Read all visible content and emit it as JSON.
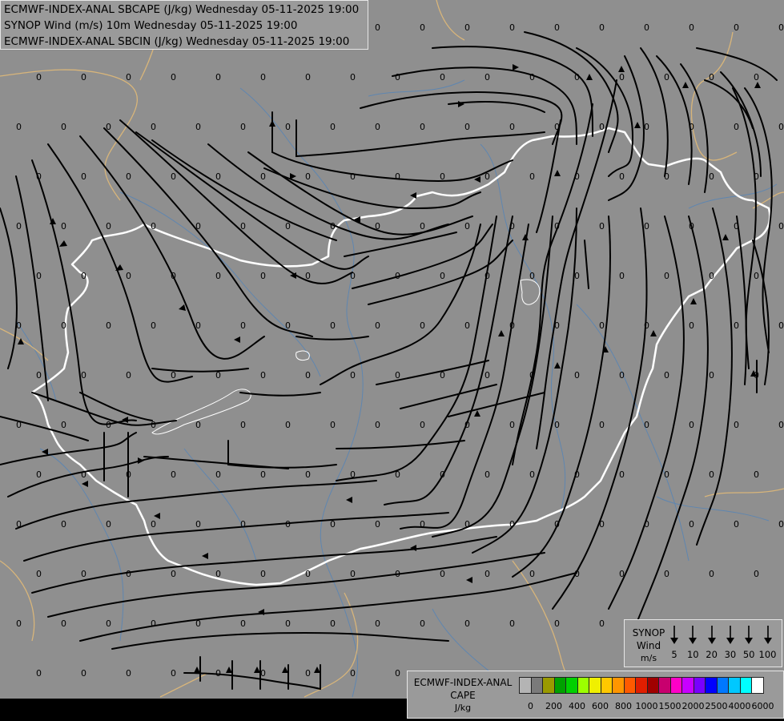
{
  "title_lines": [
    "ECMWF-INDEX-ANAL SBCAPE (J/kg) Wednesday 05-11-2025 19:00",
    "SYNOP Wind (m/s) 10m Wednesday 05-11-2025 19:00",
    "ECMWF-INDEX-ANAL SBCIN (J/kg) Wednesday 05-11-2025 19:00"
  ],
  "field_value_label": "0",
  "colors": {
    "background": "#8f8f8f",
    "streamline": "#000000",
    "border_national": "#ffffff",
    "border_regional": "#d8b57a",
    "rivers": "#5f86b0",
    "legend_bg": "#9a9a9a"
  },
  "synop_legend": {
    "title_lines": [
      "SYNOP",
      "Wind",
      "m/s"
    ],
    "icon": "wind-barb-arrow-icon",
    "values": [
      "5",
      "10",
      "20",
      "30",
      "50",
      "100"
    ]
  },
  "cape_legend": {
    "title_lines": [
      "ECMWF-INDEX-ANAL",
      "CAPE",
      "J/kg"
    ],
    "swatch_colors": [
      "#b4b4b4",
      "#7a7a7a",
      "#9a9a00",
      "#00a000",
      "#00d000",
      "#9cff00",
      "#f0f000",
      "#ffc800",
      "#ff9600",
      "#ff5a00",
      "#e01e00",
      "#a00000",
      "#c8006e",
      "#ff00c8",
      "#c800ff",
      "#7800ff",
      "#0000ff",
      "#0078ff",
      "#00c8ff",
      "#00ffff",
      "#ffffff"
    ],
    "ticks": [
      "0",
      "200",
      "400",
      "600",
      "800",
      "1000",
      "1500",
      "2000",
      "2500",
      "4000",
      "6000"
    ]
  }
}
